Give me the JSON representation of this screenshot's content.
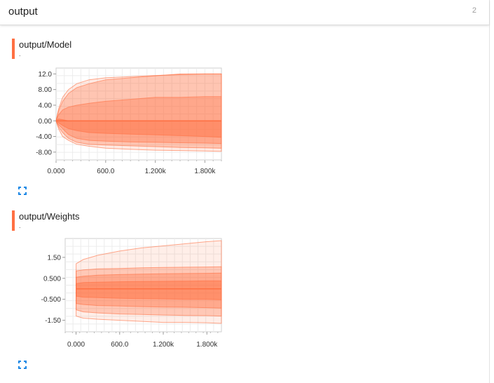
{
  "header": {
    "title": "output",
    "count": "2"
  },
  "accent_color": "#ff7043",
  "cards": [
    {
      "title": "output/Model",
      "subtitle": "."
    },
    {
      "title": "output/Weights",
      "subtitle": "."
    }
  ],
  "chart_data": [
    {
      "type": "area",
      "title": "output/Model",
      "subtitle": ".",
      "xlim": [
        0,
        2000
      ],
      "ylim": [
        -10,
        13.5
      ],
      "xticks": [
        "0.000",
        "600.0",
        "1.200k",
        "1.800k"
      ],
      "yticks": [
        "12.0",
        "8.00",
        "4.00",
        "0.00",
        "-4.00",
        "-8.00"
      ],
      "xtick_values": [
        0,
        600,
        1200,
        1800
      ],
      "ytick_values": [
        12,
        8,
        4,
        0,
        -4,
        -8
      ],
      "grid": true,
      "color": "#ff7043",
      "x": [
        0,
        30,
        80,
        150,
        250,
        400,
        600,
        900,
        1200,
        1500,
        1800,
        2000
      ],
      "bands": [
        {
          "name": "outer",
          "upper": [
            0,
            3,
            6,
            8,
            9.5,
            10.5,
            11,
            11.3,
            11.6,
            11.8,
            12,
            12
          ],
          "lower": [
            0,
            -2,
            -4,
            -5,
            -6,
            -6.5,
            -7,
            -7.3,
            -7.5,
            -7.6,
            -7.7,
            -7.8
          ],
          "opacity": 0.15
        },
        {
          "name": "p93",
          "upper": [
            0,
            2.5,
            5,
            7,
            8.5,
            9.5,
            10.5,
            11,
            11.5,
            12,
            12,
            12
          ],
          "lower": [
            0,
            -1.5,
            -3,
            -4.5,
            -5.5,
            -6,
            -6.2,
            -6.4,
            -6.6,
            -6.8,
            -6.9,
            -7
          ],
          "opacity": 0.3
        },
        {
          "name": "p84",
          "upper": [
            0,
            1.5,
            2.8,
            3.5,
            4,
            4.5,
            5,
            5.5,
            6,
            6,
            6.2,
            6.2
          ],
          "lower": [
            0,
            -1,
            -2,
            -3.5,
            -4.5,
            -5,
            -5.2,
            -5.4,
            -5.5,
            -5.6,
            -5.7,
            -5.8
          ],
          "opacity": 0.35
        },
        {
          "name": "p69",
          "upper": [
            0,
            0.5,
            0.3,
            0,
            0,
            0,
            0,
            0,
            0,
            0,
            0,
            0
          ],
          "lower": [
            0,
            -0.5,
            -1.2,
            -2,
            -2.5,
            -3,
            -3.2,
            -3.4,
            -3.6,
            -3.8,
            -4,
            -4.2
          ],
          "opacity": 0.45
        }
      ],
      "median": [
        0,
        0,
        0,
        0,
        0,
        0,
        0,
        0,
        0,
        0,
        0,
        0
      ]
    },
    {
      "type": "area",
      "title": "output/Weights",
      "subtitle": ".",
      "xlim": [
        -150,
        2000
      ],
      "ylim": [
        -2.05,
        2.4
      ],
      "xticks": [
        "0.000",
        "600.0",
        "1.200k",
        "1.800k"
      ],
      "yticks": [
        "1.50",
        "0.500",
        "-0.500",
        "-1.50"
      ],
      "xtick_values": [
        0,
        600,
        1200,
        1800
      ],
      "ytick_values": [
        1.5,
        0.5,
        -0.5,
        -1.5
      ],
      "grid": true,
      "color": "#ff7043",
      "x": [
        0,
        100,
        300,
        600,
        900,
        1200,
        1500,
        1800,
        2000
      ],
      "bands": [
        {
          "name": "outer",
          "upper": [
            1.2,
            1.4,
            1.6,
            1.8,
            1.95,
            2.05,
            2.15,
            2.25,
            2.3
          ],
          "lower": [
            -1.3,
            -1.4,
            -1.45,
            -1.5,
            -1.55,
            -1.6,
            -1.6,
            -1.62,
            -1.65
          ],
          "opacity": 0.12
        },
        {
          "name": "p93",
          "upper": [
            0.85,
            0.9,
            0.95,
            0.97,
            1.0,
            1.02,
            1.03,
            1.04,
            1.05
          ],
          "lower": [
            -1.0,
            -1.1,
            -1.15,
            -1.2,
            -1.22,
            -1.25,
            -1.27,
            -1.28,
            -1.3
          ],
          "opacity": 0.3
        },
        {
          "name": "p84",
          "upper": [
            0.55,
            0.6,
            0.65,
            0.68,
            0.7,
            0.72,
            0.73,
            0.74,
            0.75
          ],
          "lower": [
            -0.7,
            -0.75,
            -0.8,
            -0.82,
            -0.85,
            -0.87,
            -0.88,
            -0.9,
            -0.92
          ],
          "opacity": 0.35
        },
        {
          "name": "p69",
          "upper": [
            0.25,
            0.3,
            0.32,
            0.34,
            0.35,
            0.36,
            0.37,
            0.38,
            0.38
          ],
          "lower": [
            -0.35,
            -0.4,
            -0.42,
            -0.45,
            -0.47,
            -0.48,
            -0.5,
            -0.5,
            -0.52
          ],
          "opacity": 0.45
        }
      ],
      "median": [
        0,
        0,
        0,
        0,
        0,
        0,
        0,
        0,
        0
      ]
    }
  ]
}
